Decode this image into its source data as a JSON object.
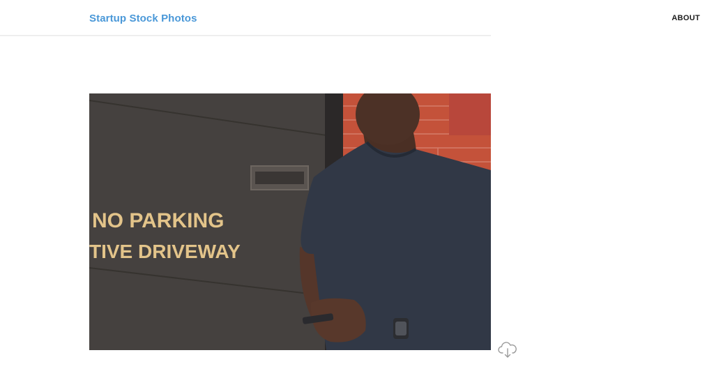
{
  "header": {
    "brand": "Startup Stock Photos",
    "nav_about": "ABOUT"
  },
  "photo": {
    "sign_line1": "NO PARKING",
    "sign_line2": "TIVE DRIVEWAY"
  },
  "icons": {
    "download": "cloud-download-icon"
  },
  "colors": {
    "brand": "#4a98d8",
    "nav_text": "#1c1c1c",
    "sign_text": "#e3c48a"
  }
}
